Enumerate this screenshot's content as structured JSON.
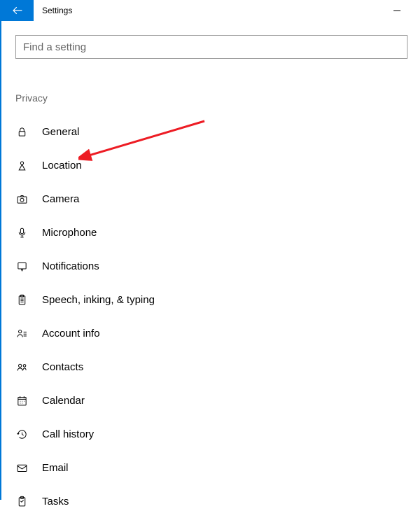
{
  "titlebar": {
    "title": "Settings"
  },
  "search": {
    "placeholder": "Find a setting"
  },
  "section_header": "Privacy",
  "nav_items": [
    {
      "id": "general",
      "label": "General",
      "icon": "lock"
    },
    {
      "id": "location",
      "label": "Location",
      "icon": "location"
    },
    {
      "id": "camera",
      "label": "Camera",
      "icon": "camera"
    },
    {
      "id": "microphone",
      "label": "Microphone",
      "icon": "microphone"
    },
    {
      "id": "notifications",
      "label": "Notifications",
      "icon": "notifications"
    },
    {
      "id": "speech",
      "label": "Speech, inking, & typing",
      "icon": "clipboard"
    },
    {
      "id": "account",
      "label": "Account info",
      "icon": "account"
    },
    {
      "id": "contacts",
      "label": "Contacts",
      "icon": "contacts"
    },
    {
      "id": "calendar",
      "label": "Calendar",
      "icon": "calendar"
    },
    {
      "id": "callhistory",
      "label": "Call history",
      "icon": "history"
    },
    {
      "id": "email",
      "label": "Email",
      "icon": "email"
    },
    {
      "id": "tasks",
      "label": "Tasks",
      "icon": "tasks"
    }
  ]
}
